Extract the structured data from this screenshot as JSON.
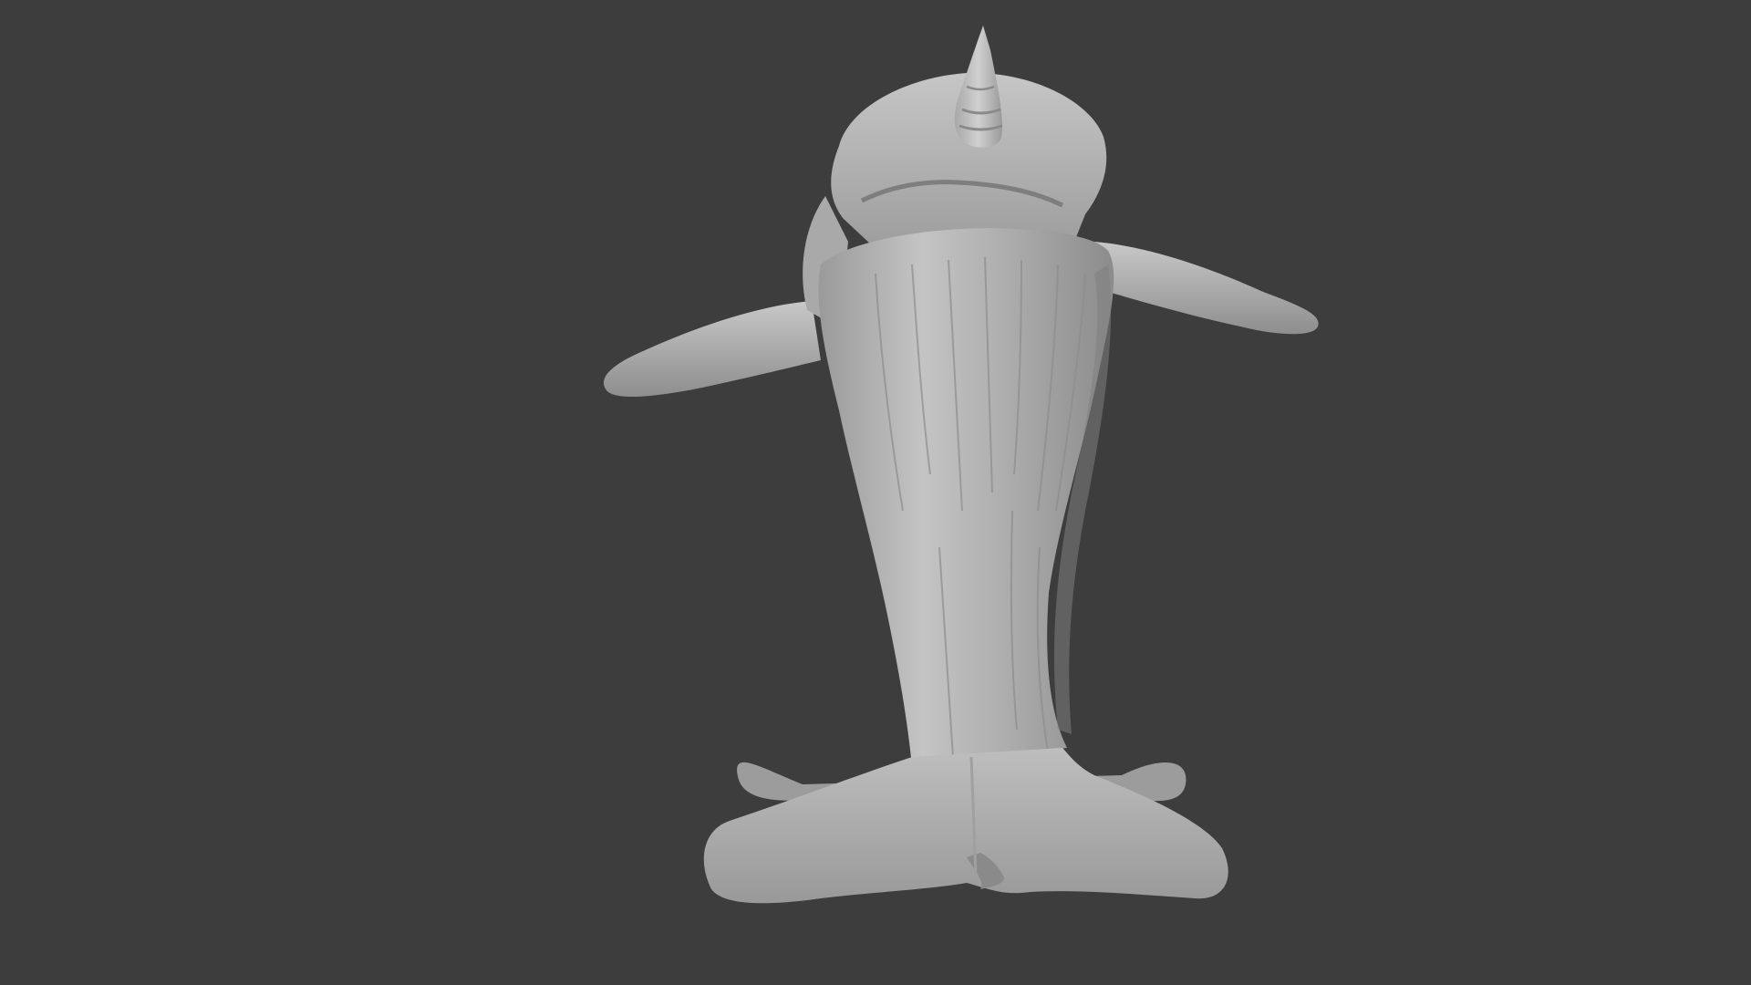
{
  "viewport": {
    "background_color": "#3d3d3d",
    "mesh_color": "#b4b4b4",
    "mesh_shadow_color": "#7a7a7a",
    "mesh_highlight_color": "#d2d2d2"
  },
  "model": {
    "icon": "sculpted-mesh-icon"
  }
}
